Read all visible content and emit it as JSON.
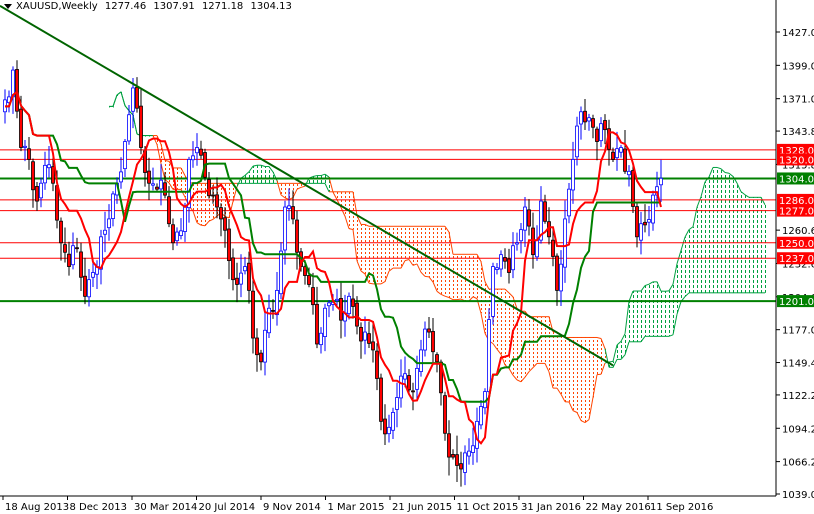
{
  "chart_data": {
    "type": "candlestick",
    "title": {
      "symbol": "XAUUSD,Weekly",
      "open": "1277.46",
      "high": "1307.91",
      "low": "1271.18",
      "close": "1304.13"
    },
    "ylim": [
      1039,
      1440
    ],
    "y_ticks": [
      "1427.00",
      "1399.00",
      "1371.00",
      "1343.80",
      "1315.80",
      "1260.60",
      "1232.60",
      "1204.60",
      "1177.00",
      "1149.40",
      "1122.20",
      "1094.20",
      "1066.20",
      "1039.00"
    ],
    "x_ticks": [
      "18 Aug 2013",
      "8 Dec 2013",
      "30 Mar 2014",
      "20 Jul 2014",
      "9 Nov 2014",
      "1 Mar 2015",
      "21 Jun 2015",
      "11 Oct 2015",
      "31 Jan 2016",
      "22 May 2016",
      "11 Sep 2016"
    ],
    "closes_biweekly_approx": [
      1370,
      1395,
      1330,
      1320,
      1285,
      1315,
      1300,
      1250,
      1230,
      1245,
      1205,
      1225,
      1255,
      1270,
      1300,
      1335,
      1380,
      1330,
      1300,
      1295,
      1290,
      1250,
      1260,
      1320,
      1330,
      1305,
      1290,
      1270,
      1235,
      1215,
      1230,
      1170,
      1150,
      1195,
      1210,
      1280,
      1270,
      1230,
      1215,
      1165,
      1195,
      1200,
      1185,
      1205,
      1180,
      1175,
      1160,
      1100,
      1095,
      1120,
      1140,
      1125,
      1160,
      1175,
      1150,
      1090,
      1070,
      1060,
      1075,
      1100,
      1125,
      1230,
      1240,
      1225,
      1250,
      1280,
      1240,
      1285,
      1255,
      1210,
      1270,
      1320,
      1360,
      1355,
      1335,
      1345,
      1320,
      1330,
      1310,
      1255,
      1265,
      1290,
      1304.13
    ],
    "levels": [
      {
        "price": 1328.0,
        "label": "1328.00",
        "color": "#ff0000"
      },
      {
        "price": 1320.0,
        "label": "1320.00",
        "color": "#ff0000"
      },
      {
        "price": 1304.0,
        "label": "1304.00",
        "color": "#008000"
      },
      {
        "price": 1286.0,
        "label": "1286.00",
        "color": "#ff0000"
      },
      {
        "price": 1277.0,
        "label": "1277.00",
        "color": "#ff0000"
      },
      {
        "price": 1250.0,
        "label": "1250.00",
        "color": "#ff0000"
      },
      {
        "price": 1237.0,
        "label": "1237.00",
        "color": "#ff0000"
      },
      {
        "price": 1201.0,
        "label": "1201.00",
        "color": "#008000"
      }
    ],
    "trendline": {
      "start_price": 1449,
      "end_price": 1147,
      "end_week": 152,
      "color": "#006400"
    },
    "indicator": "Ichimoku (tenkan red, kijun green, cloud dotted)",
    "colors": {
      "up": "#0000ff",
      "down": "#ff0000",
      "tenkan": "#ff0000",
      "kijun": "#008000",
      "bear_cloud": "#ff4500",
      "bull_cloud": "#00a040"
    }
  }
}
